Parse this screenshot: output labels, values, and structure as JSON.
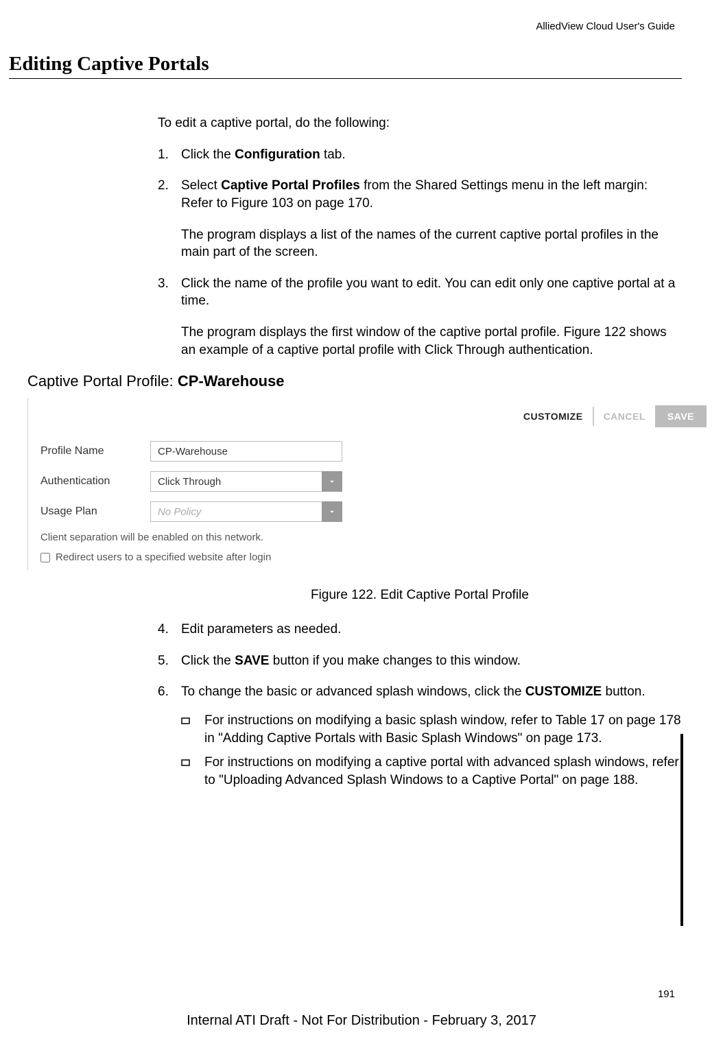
{
  "header": {
    "doc_title": "AlliedView Cloud User's Guide"
  },
  "section": {
    "title": "Editing Captive Portals"
  },
  "intro": "To edit a captive portal, do the following:",
  "steps": {
    "s1_a": "Click the ",
    "s1_b": "Configuration",
    "s1_c": " tab.",
    "s2_a": "Select ",
    "s2_b": "Captive Portal Profiles",
    "s2_c": " from the Shared Settings menu in the left margin: Refer to Figure 103 on page 170.",
    "s2_sub": "The program displays a list of the names of the current captive portal profiles in the main part of the screen.",
    "s3_a": "Click the name of the profile you want to edit. You can edit only one captive portal at a time.",
    "s3_sub": "The program displays the first window of the captive portal profile. Figure 122 shows an example of a captive portal profile with Click Through authentication.",
    "s4": "Edit parameters as needed.",
    "s5_a": "Click the ",
    "s5_b": "SAVE",
    "s5_c": " button if you make changes to this window.",
    "s6_a": "To change the basic or advanced splash windows, click the ",
    "s6_b": "CUSTOMIZE",
    "s6_c": " button.",
    "s6_sub1": "For instructions on modifying a basic splash window, refer to Table 17 on page 178 in \"Adding Captive Portals with Basic Splash Windows\" on page 173.",
    "s6_sub2": "For instructions on modifying a captive portal with advanced splash windows, refer to \"Uploading Advanced Splash Windows to a Captive Portal\" on page 188."
  },
  "figure": {
    "title_prefix": "Captive Portal Profile:",
    "title_name": "CP-Warehouse",
    "buttons": {
      "customize": "CUSTOMIZE",
      "cancel": "CANCEL",
      "save": "SAVE"
    },
    "labels": {
      "profile_name": "Profile Name",
      "authentication": "Authentication",
      "usage_plan": "Usage Plan"
    },
    "values": {
      "profile_name": "CP-Warehouse",
      "authentication": "Click Through",
      "usage_plan": "No Policy"
    },
    "note": "Client separation will be enabled on this network.",
    "checkbox_label": "Redirect users to a specified website after login",
    "caption": "Figure 122. Edit Captive Portal Profile"
  },
  "page_number": "191",
  "footer": "Internal ATI Draft - Not For Distribution - February 3, 2017"
}
